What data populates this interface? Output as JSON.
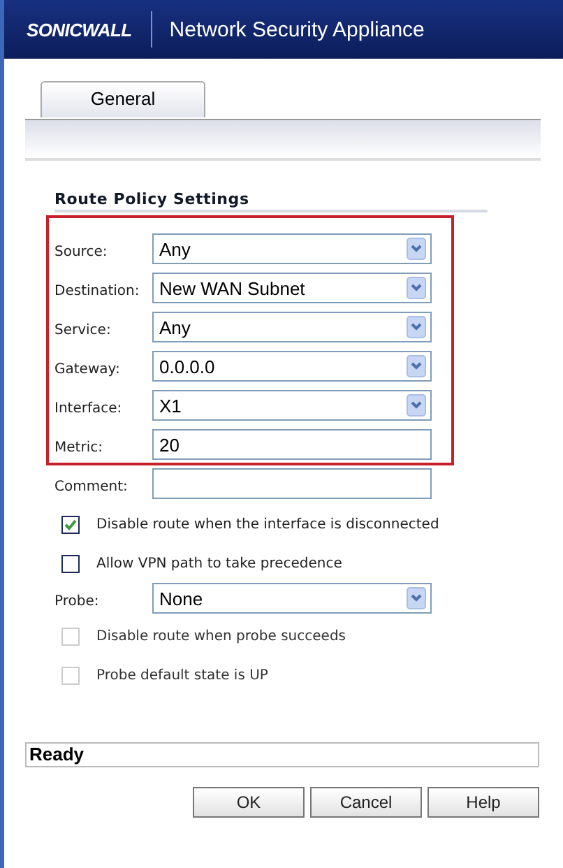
{
  "header": {
    "brand": "SONICWALL",
    "title": "Network Security Appliance"
  },
  "tabs": [
    {
      "label": "General",
      "selected": true
    }
  ],
  "section": {
    "title": "Route Policy Settings"
  },
  "boxed_rows": [
    {
      "kind": "select",
      "label": "Source:",
      "value": "Any"
    },
    {
      "kind": "select",
      "label": "Destination:",
      "value": "New WAN Subnet"
    },
    {
      "kind": "select",
      "label": "Service:",
      "value": "Any"
    },
    {
      "kind": "select",
      "label": "Gateway:",
      "value": "0.0.0.0"
    },
    {
      "kind": "select",
      "label": "Interface:",
      "value": "X1"
    },
    {
      "kind": "text",
      "label": "Metric:",
      "value": "20"
    }
  ],
  "rows": [
    {
      "kind": "text",
      "label": "Comment:"
    },
    {
      "kind": "checkbox",
      "label": "Disable route when the interface is disconnected",
      "checked": true,
      "disabled": false
    },
    {
      "kind": "checkbox",
      "label": "Allow VPN path to take precedence",
      "checked": false,
      "disabled": false
    },
    {
      "kind": "select",
      "label": "Probe:",
      "value": "None"
    },
    {
      "kind": "checkbox",
      "label": "Disable route when probe succeeds",
      "checked": false,
      "disabled": true
    },
    {
      "kind": "checkbox",
      "label": "Probe default state is UP",
      "checked": false,
      "disabled": true
    }
  ],
  "status_bar": "Ready",
  "buttons": [
    "OK",
    "Cancel",
    "Help"
  ]
}
